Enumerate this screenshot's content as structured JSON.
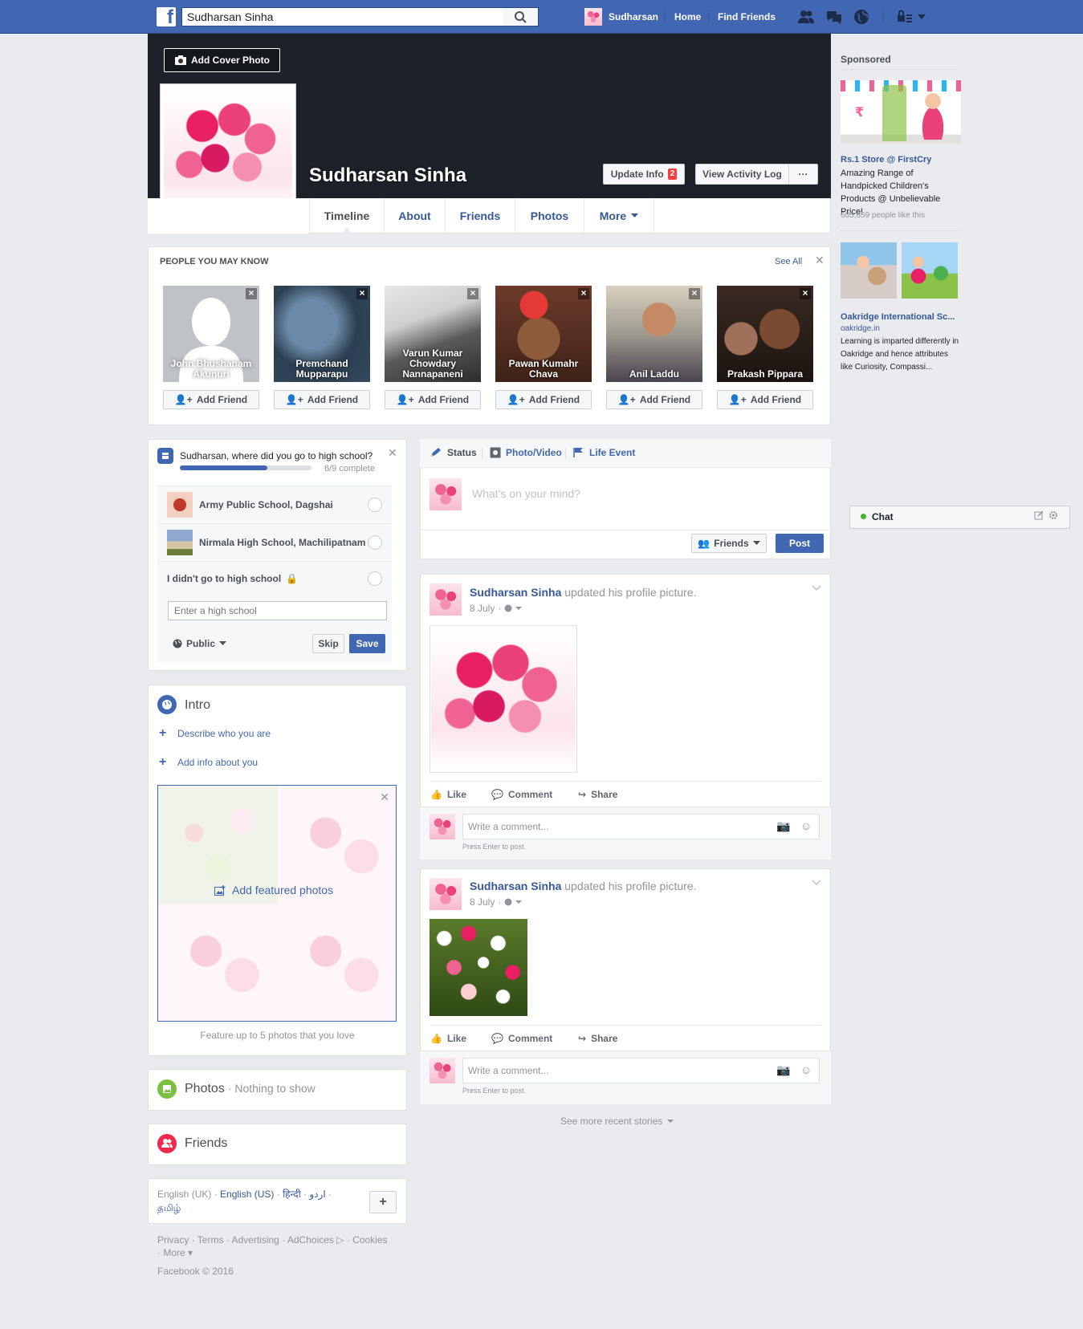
{
  "topbar": {
    "search_value": "Sudharsan Sinha",
    "profile_name": "Sudharsan",
    "home": "Home",
    "find_friends": "Find Friends"
  },
  "cover": {
    "add_cover": "Add Cover Photo",
    "name": "Sudharsan Sinha",
    "update_info": "Update Info",
    "update_badge": "2",
    "activity_log": "View Activity Log",
    "more_dots": "···"
  },
  "tabs": [
    "Timeline",
    "About",
    "Friends",
    "Photos",
    "More"
  ],
  "pymk": {
    "title": "PEOPLE YOU MAY KNOW",
    "see_all": "See All",
    "add_label": "Add Friend",
    "people": [
      {
        "name": "John Bhushanam Akunuri"
      },
      {
        "name": "Premchand Mupparapu"
      },
      {
        "name": "Varun Kumar Chowdary Nannapaneni"
      },
      {
        "name": "Pawan Kumahr Chava"
      },
      {
        "name": "Anil Laddu"
      },
      {
        "name": "Prakash Pippara"
      }
    ]
  },
  "school": {
    "question": "Sudharsan, where did you go to high school?",
    "progress": 0.667,
    "progress_text": "6/9 complete",
    "options": [
      "Army Public School, Dagshai",
      "Nirmala High School, Machilipatnam",
      "I didn't go to high school"
    ],
    "placeholder": "Enter a high school",
    "privacy": "Public",
    "skip": "Skip",
    "save": "Save"
  },
  "intro": {
    "title": "Intro",
    "describe": "Describe who you are",
    "add_info": "Add info about you",
    "featured": "Add featured photos",
    "featured_hint": "Feature up to 5 photos that you love"
  },
  "photos": {
    "title": "Photos",
    "sub": "· Nothing to show"
  },
  "friends": {
    "title": "Friends"
  },
  "languages": {
    "uk": "English (UK)",
    "us": "English (US)",
    "hi": "हिन्दी",
    "ur": "اردو",
    "ta": "தமிழ்"
  },
  "footer": {
    "privacy": "Privacy",
    "terms": "Terms",
    "advertising": "Advertising",
    "adchoices": "AdChoices",
    "cookies": "Cookies",
    "more": "More",
    "copyright": "Facebook © 2016"
  },
  "composer": {
    "status": "Status",
    "photo_video": "Photo/Video",
    "life_event": "Life Event",
    "placeholder": "What's on your mind?",
    "audience": "Friends",
    "post": "Post"
  },
  "posts": [
    {
      "name": "Sudharsan Sinha",
      "action": "updated his profile picture.",
      "date": "8 July"
    },
    {
      "name": "Sudharsan Sinha",
      "action": "updated his profile picture.",
      "date": "8 July"
    }
  ],
  "post_actions": {
    "like": "Like",
    "comment": "Comment",
    "share": "Share",
    "write": "Write a comment...",
    "press_enter": "Press Enter to post."
  },
  "see_more": "See more recent stories",
  "sidebar": {
    "sponsored": "Sponsored",
    "ad1": {
      "title": "Rs.1 Store @ FirstCry",
      "text": "Amazing Range of Handpicked Children's Products @ Unbelievable Price!",
      "likes": "605,659 people like this",
      "img_text": "₹"
    },
    "ad2": {
      "title": "Oakridge International Sc...",
      "domain": "oakridge.in",
      "text": "Learning is imparted differently in Oakridge and hence attributes like Curiosity, Compassi..."
    },
    "chat": "Chat"
  },
  "colors": {
    "brand": "#4267b2",
    "link": "#365899",
    "bg": "#e9ebee",
    "badge": "#fa3e3e"
  }
}
